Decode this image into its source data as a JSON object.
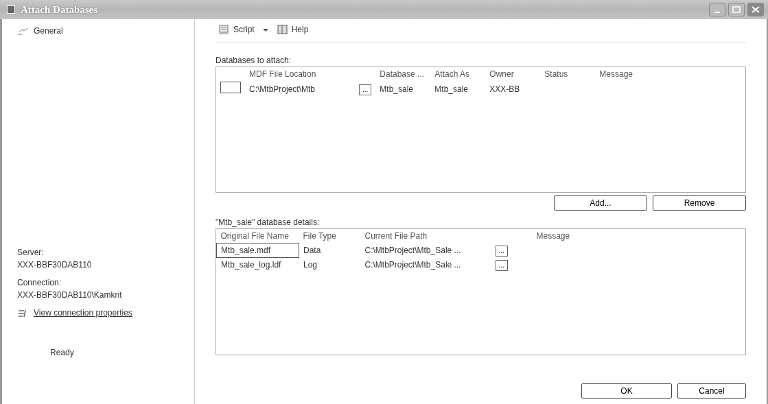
{
  "window": {
    "title": "Attach Databases"
  },
  "sidebar": {
    "items": [
      {
        "label": "General",
        "selected": true
      }
    ],
    "server_label": "Server:",
    "server": "XXX-BBF30DAB110",
    "connection_label": "Connection:",
    "connection": "XXX-BBF30DAB110\\Kamkrit",
    "link": "View connection properties",
    "status": "Ready"
  },
  "toolbar": [
    {
      "label": "Script",
      "kind": "script"
    },
    {
      "label": "Help",
      "kind": "help"
    }
  ],
  "attach": {
    "label": "Databases to attach:",
    "columns": [
      "",
      "MDF File Location",
      "",
      "Database ...",
      "Attach As",
      "Owner",
      "Status",
      "Message"
    ],
    "rows": [
      {
        "checked": false,
        "mdf": "C:\\MtbProject\\Mtb",
        "browse": "...",
        "database": "Mtb_sale",
        "attach_as": "Mtb_sale",
        "owner": "XXX-BB",
        "status": "",
        "message": ""
      }
    ],
    "buttons": [
      "Add...",
      "Remove"
    ]
  },
  "details": {
    "label": "\"Mtb_sale\" database details:",
    "columns": [
      "Original File Name",
      "File Type",
      "Current File Path",
      "",
      "Message"
    ],
    "rows": [
      {
        "name": "Mtb_sale.mdf",
        "type": "Data",
        "path": "C:\\MtbProject\\Mtb_Sale ...",
        "browse": "...",
        "selected": true
      },
      {
        "name": "Mtb_sale_log.ldf",
        "type": "Log",
        "path": "C:\\MtbProject\\Mtb_Sale ...",
        "browse": "...",
        "selected": false
      }
    ]
  },
  "buttons": [
    "OK",
    "Cancel"
  ]
}
